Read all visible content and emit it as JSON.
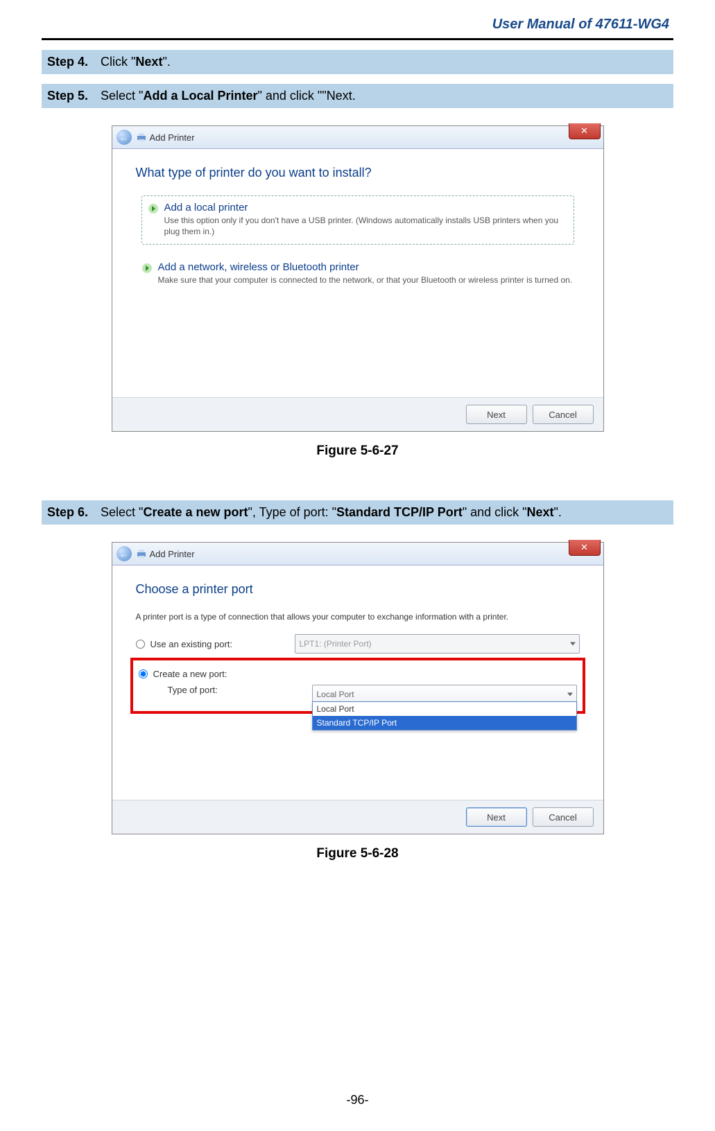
{
  "doc": {
    "header": "User Manual of 47611-WG4",
    "page_number": "-96-"
  },
  "steps": {
    "s4": {
      "label": "Step 4.",
      "pre": "Click \"",
      "bold1": "Next",
      "post": "\"."
    },
    "s5": {
      "label": "Step 5.",
      "pre": "Select \"",
      "bold1": "Add a Local Printer",
      "post": "\" and click \"\"Next."
    },
    "s6": {
      "label": "Step 6.",
      "pre": "Select \"",
      "bold1": "Create a new port",
      "mid1": "\", Type of port: \"",
      "bold2": "Standard TCP/IP Port",
      "mid2": "\" and click \"",
      "bold3": "Next",
      "post": "\"."
    }
  },
  "captions": {
    "fig1": "Figure 5-6-27",
    "fig2": "Figure 5-6-28"
  },
  "dialog1": {
    "title": "Add Printer",
    "heading": "What type of printer do you want to install?",
    "opt1_title": "Add a local printer",
    "opt1_sub": "Use this option only if you don't have a USB printer. (Windows automatically installs USB printers when you plug them in.)",
    "opt2_title": "Add a network, wireless or Bluetooth printer",
    "opt2_sub": "Make sure that your computer is connected to the network, or that your Bluetooth or wireless printer is turned on.",
    "btn_next": "Next",
    "btn_cancel": "Cancel"
  },
  "dialog2": {
    "title": "Add Printer",
    "heading": "Choose a printer port",
    "subtext": "A printer port is a type of connection that allows your computer to exchange information with a printer.",
    "radio_existing": "Use an existing port:",
    "existing_value": "LPT1: (Printer Port)",
    "radio_create": "Create a new port:",
    "type_label": "Type of port:",
    "combo_value": "Local Port",
    "dd_opt1": "Local Port",
    "dd_opt2": "Standard TCP/IP Port",
    "btn_next": "Next",
    "btn_cancel": "Cancel"
  }
}
